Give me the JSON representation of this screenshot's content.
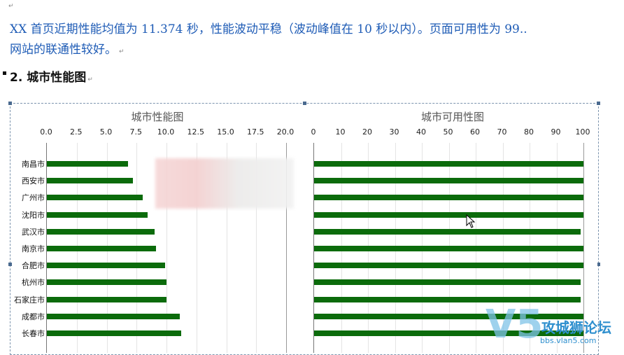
{
  "doc": {
    "para_mark": "↵",
    "intro_line1": "XX 首页近期性能均值为 11.374 秒，性能波动平稳（波动峰值在 10 秒以内）。页面可用性为 99..",
    "intro_line2": "网站的联通性较好。",
    "heading_number": "2.",
    "heading_text": "城市性能图"
  },
  "chart_data": [
    {
      "type": "bar",
      "orientation": "horizontal",
      "title": "城市性能图",
      "categories": [
        "南昌市",
        "西安市",
        "广州市",
        "沈阳市",
        "武汉市",
        "南京市",
        "合肥市",
        "杭州市",
        "石家庄市",
        "成都市",
        "长春市"
      ],
      "values": [
        6.8,
        7.2,
        8.0,
        8.4,
        9.0,
        9.1,
        9.9,
        10.0,
        10.0,
        11.1,
        11.2
      ],
      "xticks": [
        "0.0",
        "2.5",
        "5.0",
        "7.5",
        "10.0",
        "12.5",
        "15.0",
        "17.5",
        "20.0"
      ],
      "xlim": [
        0,
        20
      ],
      "grid": true,
      "bar_color": "#0b6b0b"
    },
    {
      "type": "bar",
      "orientation": "horizontal",
      "title": "城市可用性图",
      "categories": [
        "南昌市",
        "西安市",
        "广州市",
        "沈阳市",
        "武汉市",
        "南京市",
        "合肥市",
        "杭州市",
        "石家庄市",
        "成都市",
        "长春市"
      ],
      "values": [
        100,
        100,
        100,
        100,
        99,
        100,
        100,
        99,
        99,
        100,
        100
      ],
      "xticks": [
        "0",
        "10",
        "20",
        "30",
        "40",
        "50",
        "60",
        "70",
        "80",
        "90",
        "100"
      ],
      "xlim": [
        0,
        100
      ],
      "grid": true,
      "bar_color": "#0b6b0b"
    }
  ],
  "watermark": {
    "logo_letter": "V5",
    "title": "攻城狮论坛",
    "url": "bbs.vlan5.com"
  }
}
